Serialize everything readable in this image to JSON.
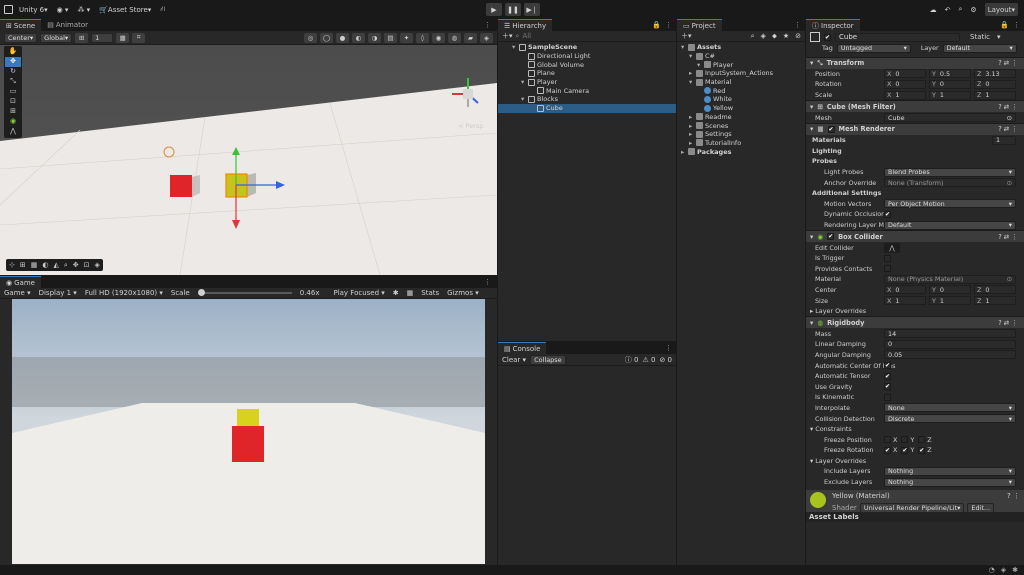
{
  "topbar": {
    "account": "Unity 6",
    "asset_store": "Asset Store",
    "layout": "Layout"
  },
  "scene": {
    "tabs": [
      "Scene",
      "Animator"
    ],
    "pivot": "Center",
    "space": "Global",
    "snap_value": "1",
    "gizmo_label": "< Persp"
  },
  "game": {
    "tab": "Game",
    "display_mode": "Game",
    "display": "Display 1",
    "resolution": "Full HD (1920x1080)",
    "scale_label": "Scale",
    "scale_value": "0.46x",
    "play_mode": "Play Focused",
    "stats": "Stats",
    "gizmos": "Gizmos"
  },
  "hierarchy": {
    "tab": "Hierarchy",
    "search_placeholder": "All",
    "items": [
      {
        "label": "SampleScene",
        "depth": 0,
        "bold": true
      },
      {
        "label": "Directional Light",
        "depth": 1
      },
      {
        "label": "Global Volume",
        "depth": 1
      },
      {
        "label": "Plane",
        "depth": 1
      },
      {
        "label": "Player",
        "depth": 1
      },
      {
        "label": "Main Camera",
        "depth": 2
      },
      {
        "label": "Blocks",
        "depth": 1
      },
      {
        "label": "Cube",
        "depth": 2,
        "selected": true
      }
    ]
  },
  "project": {
    "tab": "Project",
    "items": [
      {
        "label": "Assets",
        "depth": 0,
        "bold": true
      },
      {
        "label": "C#",
        "depth": 1
      },
      {
        "label": "Player",
        "depth": 2
      },
      {
        "label": "InputSystem_Actions",
        "depth": 1
      },
      {
        "label": "Material",
        "depth": 1
      },
      {
        "label": "Red",
        "depth": 2
      },
      {
        "label": "White",
        "depth": 2
      },
      {
        "label": "Yellow",
        "depth": 2
      },
      {
        "label": "Readme",
        "depth": 1
      },
      {
        "label": "Scenes",
        "depth": 1
      },
      {
        "label": "Settings",
        "depth": 1
      },
      {
        "label": "TutorialInfo",
        "depth": 1
      },
      {
        "label": "Packages",
        "depth": 0,
        "bold": true
      }
    ]
  },
  "console": {
    "tab": "Console",
    "clear": "Clear",
    "collapse": "Collapse",
    "logs": "0",
    "warnings": "0",
    "errors": "0"
  },
  "inspector": {
    "tab": "Inspector",
    "object_name": "Cube",
    "static": "Static",
    "tag_label": "Tag",
    "tag_value": "Untagged",
    "layer_label": "Layer",
    "layer_value": "Default",
    "transform": {
      "title": "Transform",
      "position_label": "Position",
      "rotation_label": "Rotation",
      "scale_label": "Scale",
      "position": [
        "0",
        "0.5",
        "3.13"
      ],
      "rotation": [
        "0",
        "0",
        "0"
      ],
      "scale": [
        "1",
        "1",
        "1"
      ]
    },
    "mesh_filter": {
      "title": "Cube (Mesh Filter)",
      "mesh_label": "Mesh",
      "mesh_value": "Cube"
    },
    "mesh_renderer": {
      "title": "Mesh Renderer",
      "materials_label": "Materials",
      "materials_count": "1",
      "lighting_label": "Lighting",
      "probes_label": "Probes",
      "light_probes_label": "Light Probes",
      "light_probes_value": "Blend Probes",
      "anchor_label": "Anchor Override",
      "anchor_value": "None (Transform)",
      "additional_label": "Additional Settings",
      "motion_label": "Motion Vectors",
      "motion_value": "Per Object Motion",
      "occlusion_label": "Dynamic Occlusion",
      "layer_mask_label": "Rendering Layer Mask",
      "layer_mask_value": "Default"
    },
    "box_collider": {
      "title": "Box Collider",
      "edit_label": "Edit Collider",
      "trigger_label": "Is Trigger",
      "contacts_label": "Provides Contacts",
      "material_label": "Material",
      "material_value": "None (Physics Material)",
      "center_label": "Center",
      "size_label": "Size",
      "center": [
        "0",
        "0",
        "0"
      ],
      "size": [
        "1",
        "1",
        "1"
      ],
      "overrides_label": "Layer Overrides"
    },
    "rigidbody": {
      "title": "Rigidbody",
      "mass_label": "Mass",
      "mass_value": "14",
      "lin_label": "Linear Damping",
      "lin_value": "0",
      "ang_label": "Angular Damping",
      "ang_value": "0.05",
      "com_label": "Automatic Center Of Mas",
      "tensor_label": "Automatic Tensor",
      "gravity_label": "Use Gravity",
      "kinematic_label": "Is Kinematic",
      "interp_label": "Interpolate",
      "interp_value": "None",
      "collision_label": "Collision Detection",
      "collision_value": "Discrete",
      "constraints_label": "Constraints",
      "freeze_pos_label": "Freeze Position",
      "freeze_rot_label": "Freeze Rotation",
      "layer_overrides_label": "Layer Overrides",
      "include_label": "Include Layers",
      "include_value": "Nothing",
      "exclude_label": "Exclude Layers",
      "exclude_value": "Nothing"
    },
    "material": {
      "title": "Yellow (Material)",
      "shader_label": "Shader",
      "shader_value": "Universal Render Pipeline/Lit",
      "edit": "Edit..."
    },
    "asset_labels": "Asset Labels"
  },
  "colors": {
    "accent": "#3a79bb",
    "selection": "#2c5d87",
    "red_cube": "#e0252a",
    "yellow_cube": "#d8d21c"
  }
}
